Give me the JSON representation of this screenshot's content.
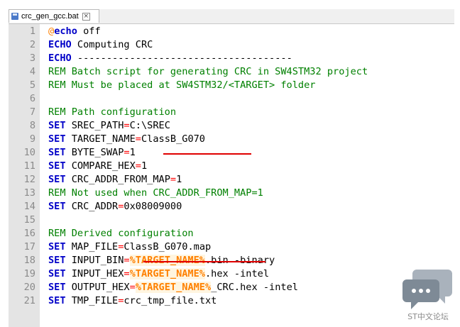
{
  "tab": {
    "label": "crc_gen_gcc.bat",
    "icon": "save-disk-icon",
    "close_icon": "close-icon"
  },
  "watermark": {
    "caption": "ST中文论坛",
    "icon": "chat-bubble-icon"
  },
  "colors": {
    "keyword": "#0000c8",
    "operator": "#ff0000",
    "comment": "#008000",
    "variable": "#ff8000",
    "gutter": "#e4e4e4",
    "annotation_underline": "#e00000"
  },
  "lines": [
    {
      "n": "1",
      "tokens": [
        {
          "t": "@",
          "c": "at"
        },
        {
          "t": "echo",
          "c": "kw"
        },
        {
          "t": " off",
          "c": "tx"
        }
      ]
    },
    {
      "n": "2",
      "tokens": [
        {
          "t": "ECHO",
          "c": "kw"
        },
        {
          "t": " Computing CRC",
          "c": "tx"
        }
      ]
    },
    {
      "n": "3",
      "tokens": [
        {
          "t": "ECHO",
          "c": "kw"
        },
        {
          "t": " -------------------------------------",
          "c": "tx"
        }
      ]
    },
    {
      "n": "4",
      "tokens": [
        {
          "t": "REM Batch script for generating CRC in SW4STM32 project",
          "c": "rem"
        }
      ]
    },
    {
      "n": "5",
      "tokens": [
        {
          "t": "REM Must be placed at SW4STM32/<TARGET> folder",
          "c": "rem"
        }
      ]
    },
    {
      "n": "6",
      "tokens": []
    },
    {
      "n": "7",
      "tokens": [
        {
          "t": "REM Path configuration",
          "c": "rem"
        }
      ]
    },
    {
      "n": "8",
      "tokens": [
        {
          "t": "SET",
          "c": "kw"
        },
        {
          "t": " SREC_PATH",
          "c": "tx"
        },
        {
          "t": "=",
          "c": "op"
        },
        {
          "t": "C:\\SREC",
          "c": "tx"
        }
      ]
    },
    {
      "n": "9",
      "tokens": [
        {
          "t": "SET",
          "c": "kw"
        },
        {
          "t": " TARGET_NAME",
          "c": "tx"
        },
        {
          "t": "=",
          "c": "op"
        },
        {
          "t": "ClassB_G070",
          "c": "tx"
        }
      ]
    },
    {
      "n": "10",
      "tokens": [
        {
          "t": "SET",
          "c": "kw"
        },
        {
          "t": " BYTE_SWAP",
          "c": "tx"
        },
        {
          "t": "=",
          "c": "op"
        },
        {
          "t": "1",
          "c": "tx"
        }
      ]
    },
    {
      "n": "11",
      "tokens": [
        {
          "t": "SET",
          "c": "kw"
        },
        {
          "t": " COMPARE_HEX",
          "c": "tx"
        },
        {
          "t": "=",
          "c": "op"
        },
        {
          "t": "1",
          "c": "tx"
        }
      ]
    },
    {
      "n": "12",
      "tokens": [
        {
          "t": "SET",
          "c": "kw"
        },
        {
          "t": " CRC_ADDR_FROM_MAP",
          "c": "tx"
        },
        {
          "t": "=",
          "c": "op"
        },
        {
          "t": "1",
          "c": "tx"
        }
      ]
    },
    {
      "n": "13",
      "tokens": [
        {
          "t": "REM Not used when CRC_ADDR_FROM_MAP=1",
          "c": "rem"
        }
      ]
    },
    {
      "n": "14",
      "tokens": [
        {
          "t": "SET",
          "c": "kw"
        },
        {
          "t": " CRC_ADDR",
          "c": "tx"
        },
        {
          "t": "=",
          "c": "op"
        },
        {
          "t": "0x08009000",
          "c": "tx"
        }
      ]
    },
    {
      "n": "15",
      "tokens": []
    },
    {
      "n": "16",
      "tokens": [
        {
          "t": "REM Derived configuration",
          "c": "rem"
        }
      ]
    },
    {
      "n": "17",
      "tokens": [
        {
          "t": "SET",
          "c": "kw"
        },
        {
          "t": " MAP_FILE",
          "c": "tx"
        },
        {
          "t": "=",
          "c": "op"
        },
        {
          "t": "ClassB_G070.map",
          "c": "tx"
        }
      ]
    },
    {
      "n": "18",
      "tokens": [
        {
          "t": "SET",
          "c": "kw"
        },
        {
          "t": " INPUT_BIN",
          "c": "tx"
        },
        {
          "t": "=",
          "c": "op"
        },
        {
          "t": "%TARGET_NAME%",
          "c": "var"
        },
        {
          "t": ".bin -binary",
          "c": "tx"
        }
      ]
    },
    {
      "n": "19",
      "tokens": [
        {
          "t": "SET",
          "c": "kw"
        },
        {
          "t": " INPUT_HEX",
          "c": "tx"
        },
        {
          "t": "=",
          "c": "op"
        },
        {
          "t": "%TARGET_NAME%",
          "c": "var"
        },
        {
          "t": ".hex -intel",
          "c": "tx"
        }
      ]
    },
    {
      "n": "20",
      "tokens": [
        {
          "t": "SET",
          "c": "kw"
        },
        {
          "t": " OUTPUT_HEX",
          "c": "tx"
        },
        {
          "t": "=",
          "c": "op"
        },
        {
          "t": "%TARGET_NAME%",
          "c": "var"
        },
        {
          "t": "_CRC.hex -intel",
          "c": "tx"
        }
      ]
    },
    {
      "n": "21",
      "tokens": [
        {
          "t": "SET",
          "c": "kw"
        },
        {
          "t": " TMP_FILE",
          "c": "tx"
        },
        {
          "t": "=",
          "c": "op"
        },
        {
          "t": "crc_tmp_file.txt",
          "c": "tx"
        }
      ]
    }
  ]
}
